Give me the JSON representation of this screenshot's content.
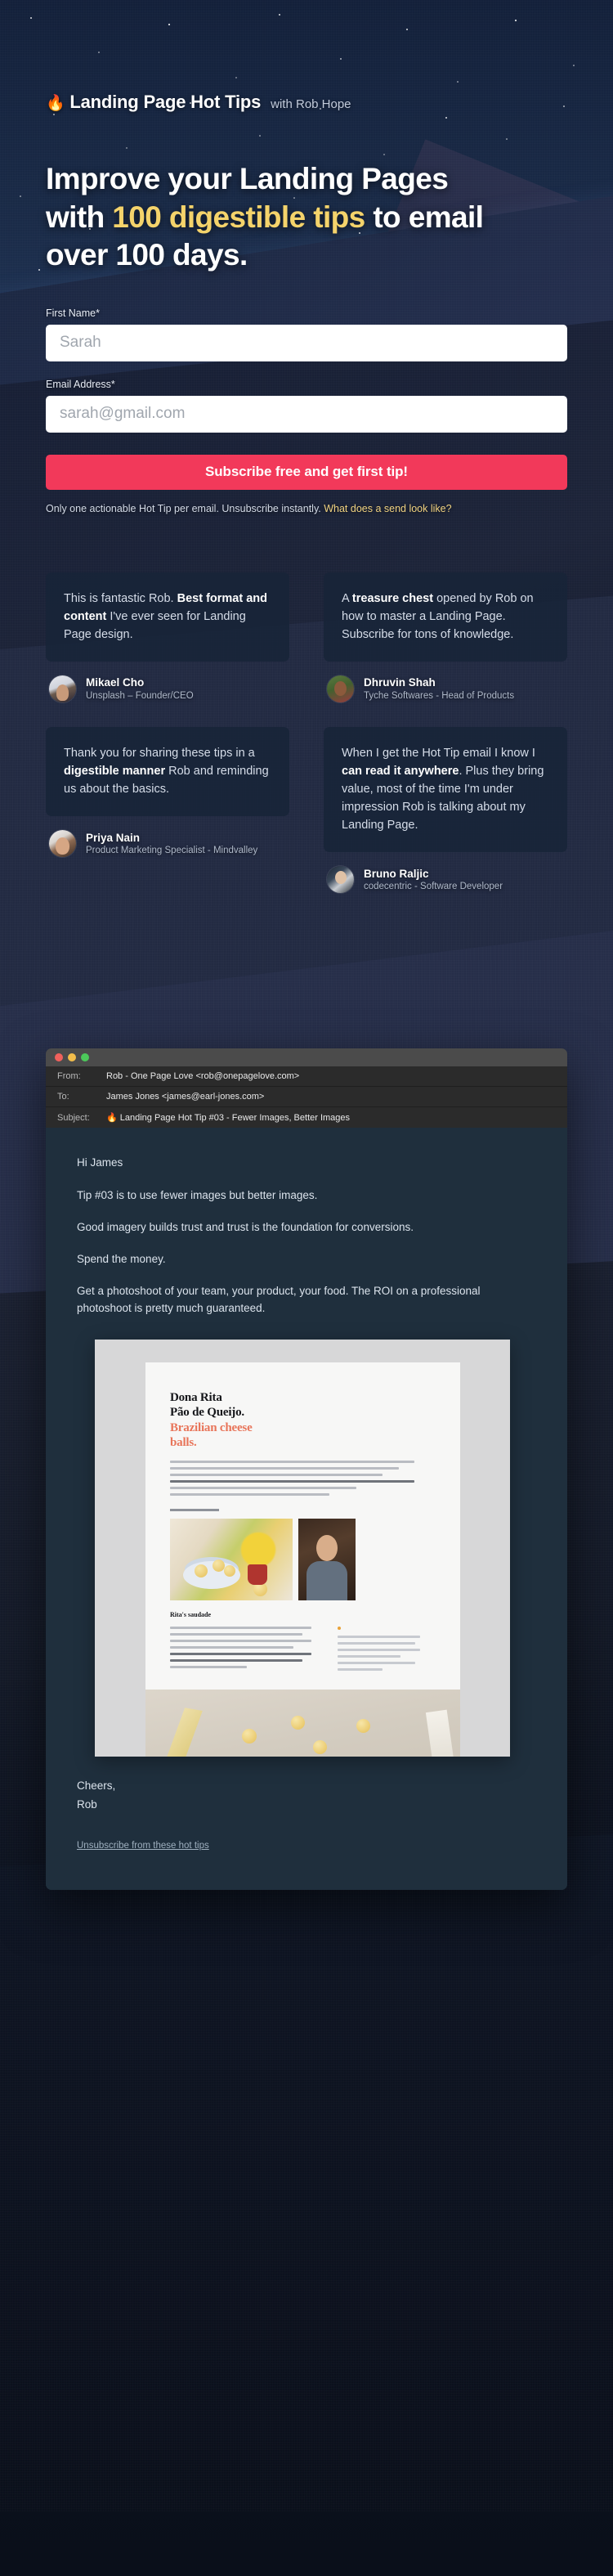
{
  "brand": {
    "flame_icon": "flame-icon",
    "title": "Landing Page Hot Tips",
    "with": "with Rob Hope"
  },
  "hero": {
    "line1": "Improve your Landing Pages",
    "line2_pre": "with ",
    "line2_accent": "100 digestible tips",
    "line2_post": " to email",
    "line3": "over 100 days.",
    "accent_color": "#f4d36b"
  },
  "form": {
    "first_name_label": "First Name*",
    "first_name_placeholder": "Sarah",
    "first_name_value": "",
    "email_label": "Email Address*",
    "email_placeholder": "sarah@gmail.com",
    "email_value": "",
    "cta_label": "Subscribe free and get first tip!",
    "cta_color": "#f2395a",
    "fineprint_text": "Only one actionable Hot Tip per email. Unsubscribe instantly. ",
    "fineprint_link": "What does a send look like?"
  },
  "testimonials": [
    {
      "quote_pre": "This is fantastic Rob. ",
      "quote_bold": "Best format and content",
      "quote_post": " I've ever seen for Landing Page design.",
      "name": "Mikael Cho",
      "role": "Unsplash – Founder/CEO"
    },
    {
      "quote_pre": "A ",
      "quote_bold": "treasure chest",
      "quote_post": " opened by Rob on how to master a Landing Page. Subscribe for tons of knowledge.",
      "name": "Dhruvin Shah",
      "role": "Tyche Softwares - Head of Products"
    },
    {
      "quote_pre": "Thank you for sharing these tips in a ",
      "quote_bold": "digestible manner",
      "quote_post": " Rob and reminding us about the basics.",
      "name": "Priya Nain",
      "role": "Product Marketing Specialist - Mindvalley"
    },
    {
      "quote_pre": "When I get the Hot Tip email I know I ",
      "quote_bold": "can read it anywhere",
      "quote_post": ". Plus they bring value, most of the time I'm under impression Rob is talking about my Landing Page.",
      "name": "Bruno Raljic",
      "role": "codecentric - Software Developer"
    }
  ],
  "email": {
    "window_controls": [
      "close-dot",
      "minimize-dot",
      "maximize-dot"
    ],
    "from_key": "From:",
    "from_value": "Rob - One Page Love <rob@onepagelove.com>",
    "to_key": "To:",
    "to_value": "James Jones <james@earl-jones.com>",
    "subject_key": "Subject:",
    "subject_flame": "🔥",
    "subject_value": "Landing Page Hot Tip #03 - Fewer Images, Better Images",
    "greeting": "Hi James",
    "para1": "Tip #03 is to use fewer images but better images.",
    "para2": "Good imagery builds trust and trust is the foundation for conversions.",
    "para3": "Spend the money.",
    "para4": "Get a photoshoot of your team, your product, your food. The ROI on a professional photoshoot is pretty much guaranteed.",
    "signoff_1": "Cheers,",
    "signoff_2": "Rob",
    "unsubscribe": "Unsubscribe from these hot tips"
  },
  "screenshot": {
    "lp_title_line1": "Dona Rita",
    "lp_title_line2": "Pão de Queijo.",
    "lp_title_accent_1": "Brazilian cheese",
    "lp_title_accent_2": "balls.",
    "lp_subheading": "Rita's saudade",
    "lp_accent_color": "#e8755a"
  }
}
